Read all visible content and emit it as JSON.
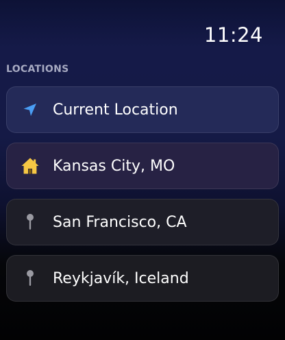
{
  "status": {
    "time": "11:24"
  },
  "section": {
    "title": "LOCATIONS"
  },
  "locations": [
    {
      "label": "Current Location",
      "icon": "location-arrow-icon",
      "color": "#4a9ef5"
    },
    {
      "label": "Kansas City, MO",
      "icon": "home-icon",
      "color": "#f6c744"
    },
    {
      "label": "San Francisco, CA",
      "icon": "pin-icon",
      "color": "#9a9aa2"
    },
    {
      "label": "Reykjavík, Iceland",
      "icon": "pin-icon",
      "color": "#9a9aa2"
    }
  ]
}
